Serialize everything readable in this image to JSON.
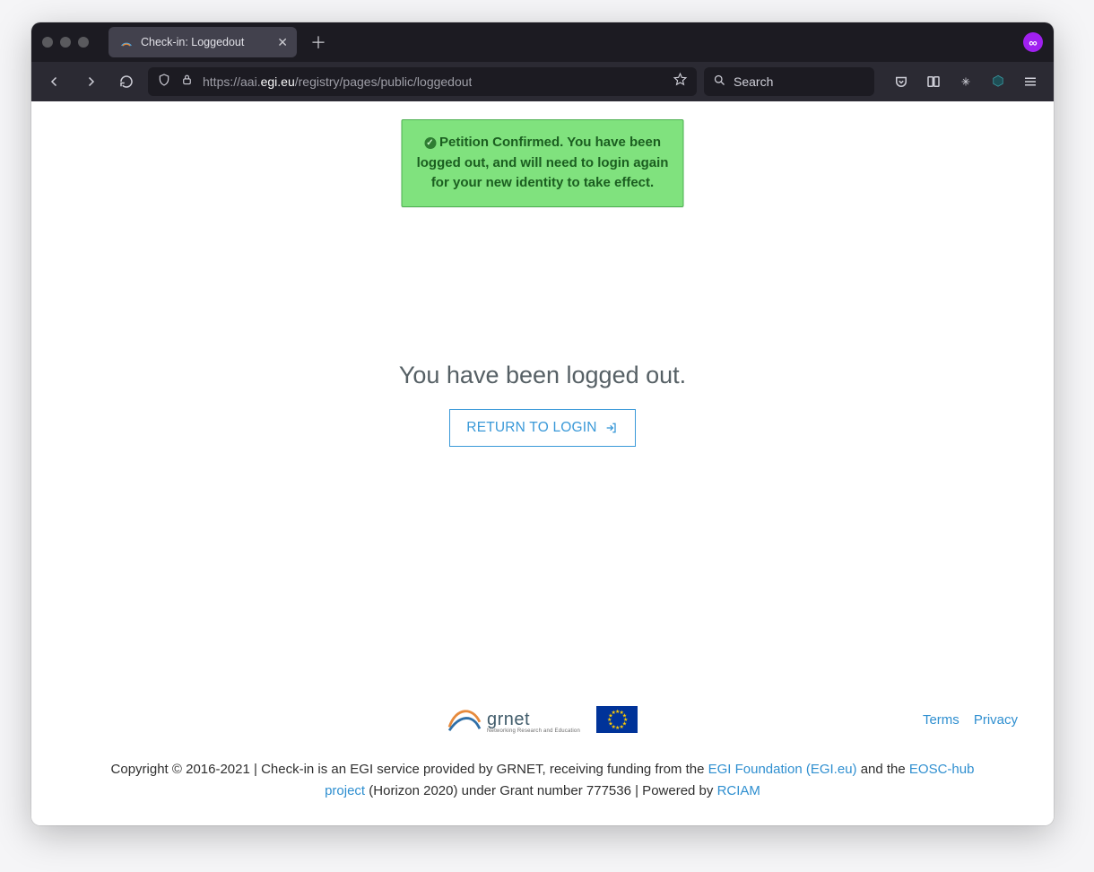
{
  "browser": {
    "tab_title": "Check-in: Loggedout",
    "url_prefix": "https://aai.",
    "url_host_strong": "egi.eu",
    "url_path": "/registry/pages/public/loggedout",
    "search_placeholder": "Search"
  },
  "toast": {
    "message": "Petition Confirmed. You have been logged out, and will need to login again for your new identity to take effect."
  },
  "main": {
    "heading": "You have been logged out.",
    "return_label": "RETURN TO LOGIN"
  },
  "footer": {
    "grnet_name": "grnet",
    "grnet_sub": "Networking Research and Education",
    "links": {
      "terms": "Terms",
      "privacy": "Privacy"
    },
    "copy_1": "Copyright © 2016-2021 | Check-in is an EGI service provided by GRNET, receiving funding from the ",
    "link_egi": "EGI Foundation (EGI.eu)",
    "copy_2": " and the ",
    "link_eosc": "EOSC-hub project",
    "copy_3": " (Horizon 2020) under Grant number 777536 | Powered by ",
    "link_rciam": "RCIAM"
  }
}
